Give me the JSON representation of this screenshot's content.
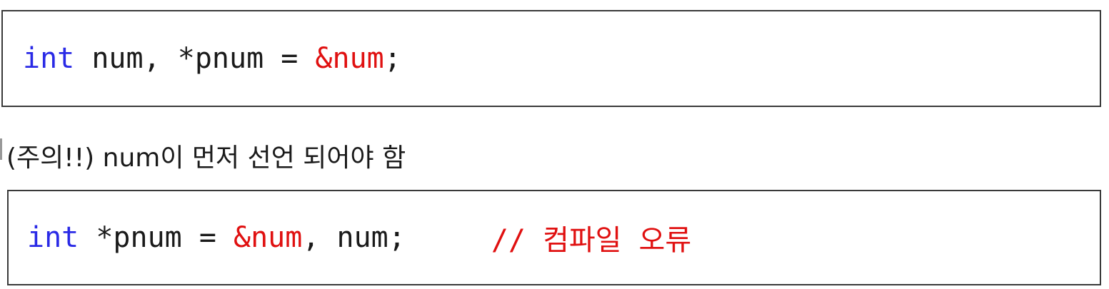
{
  "code1": {
    "kw": "int",
    "part1": " num, *pnum = ",
    "ref": "&num",
    "part2": ";"
  },
  "note": {
    "text": "(주의!!) num이 먼저 선언 되어야 함"
  },
  "code2": {
    "kw": "int",
    "part1": " *pnum = ",
    "ref": "&num",
    "part2": ", num;",
    "comment": "// 컴파일 오류"
  },
  "colors": {
    "keyword": "#2a2ae6",
    "highlight": "#e01010",
    "text": "#1a1a1a",
    "border": "#3a3a3a"
  }
}
